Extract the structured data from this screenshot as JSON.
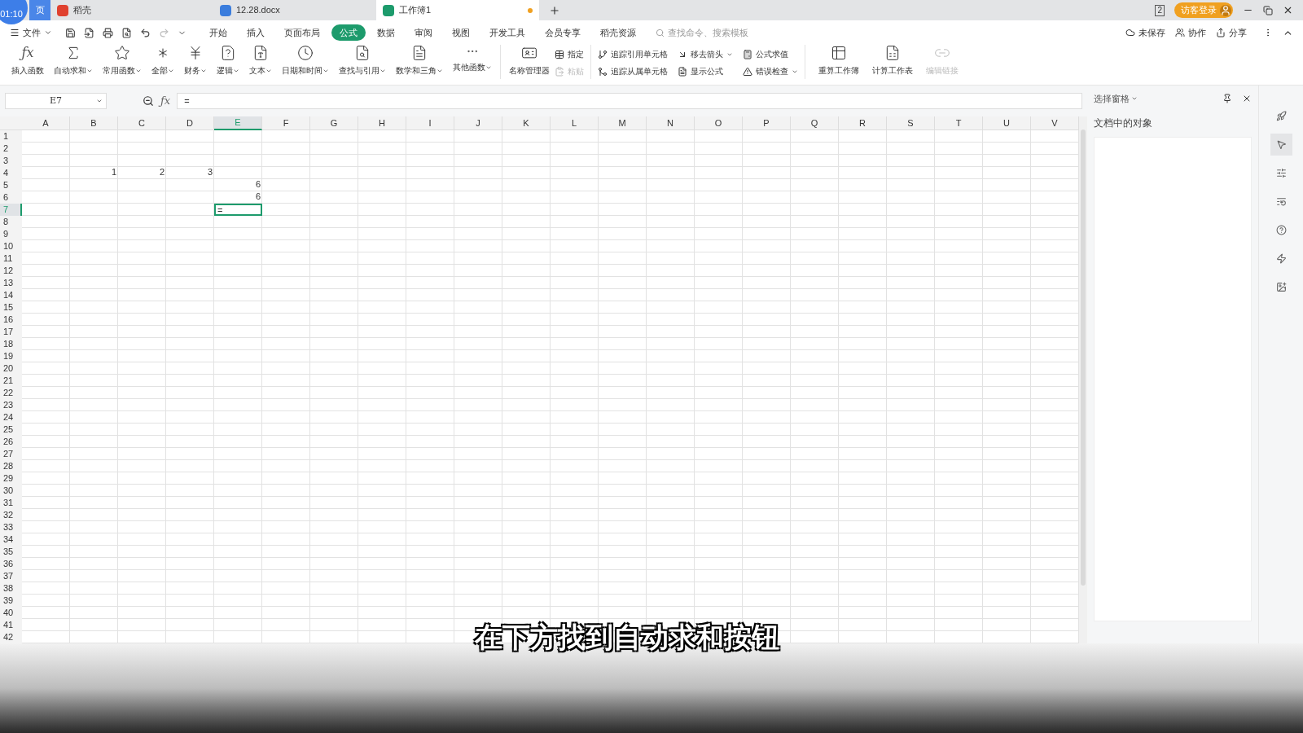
{
  "recording_timer": "01:10",
  "tabs": [
    {
      "label": "页",
      "kind": "home",
      "selected": false,
      "unsaved": false
    },
    {
      "label": "稻壳",
      "kind": "docer",
      "selected": false,
      "unsaved": false
    },
    {
      "label": "12.28.docx",
      "kind": "doc",
      "selected": false,
      "unsaved": false
    },
    {
      "label": "工作簿1",
      "kind": "sheet",
      "selected": true,
      "unsaved": true
    }
  ],
  "window_badge": "2",
  "login_button": "访客登录",
  "file_menu": "文件",
  "menu_tabs": [
    {
      "label": "开始",
      "selected": false
    },
    {
      "label": "插入",
      "selected": false
    },
    {
      "label": "页面布局",
      "selected": false
    },
    {
      "label": "公式",
      "selected": true
    },
    {
      "label": "数据",
      "selected": false
    },
    {
      "label": "审阅",
      "selected": false
    },
    {
      "label": "视图",
      "selected": false
    },
    {
      "label": "开发工具",
      "selected": false
    },
    {
      "label": "会员专享",
      "selected": false
    },
    {
      "label": "稻壳资源",
      "selected": false
    }
  ],
  "command_search": {
    "placeholder": "查找命令、搜索模板"
  },
  "header_actions": [
    {
      "label": "未保存",
      "kind": "cloud"
    },
    {
      "label": "协作",
      "kind": "people"
    },
    {
      "label": "分享",
      "kind": "share"
    }
  ],
  "ribbon_functions": [
    {
      "label": "插入函数",
      "kind": "fx",
      "symbol": "ƒx",
      "dropdown": false
    },
    {
      "label": "自动求和",
      "kind": "sigma",
      "dropdown": true
    },
    {
      "label": "常用函数",
      "kind": "star",
      "dropdown": true
    },
    {
      "label": "全部",
      "kind": "asterisk",
      "dropdown": true
    },
    {
      "label": "财务",
      "kind": "yen",
      "dropdown": true
    },
    {
      "label": "逻辑",
      "kind": "question",
      "dropdown": true
    },
    {
      "label": "文本",
      "kind": "text",
      "dropdown": true
    },
    {
      "label": "日期和时间",
      "kind": "clock",
      "dropdown": true
    },
    {
      "label": "查找与引用",
      "kind": "search",
      "dropdown": true
    },
    {
      "label": "数学和三角",
      "kind": "math",
      "dropdown": true
    },
    {
      "label": "其他函数",
      "kind": "more",
      "dropdown": true
    }
  ],
  "ribbon_names": {
    "big": {
      "label": "名称管理器"
    },
    "small": [
      {
        "label": "指定",
        "disabled": false
      },
      {
        "label": "粘贴",
        "disabled": true
      }
    ]
  },
  "ribbon_audit": [
    {
      "label": "追踪引用单元格",
      "kind": "trace",
      "dropdown": false
    },
    {
      "label": "追踪从属单元格",
      "kind": "dependents",
      "dropdown": false
    },
    {
      "label": "移去箭头",
      "kind": "remove",
      "dropdown": true
    },
    {
      "label": "显示公式",
      "kind": "showfx",
      "dropdown": false
    },
    {
      "label": "公式求值",
      "kind": "evaluate",
      "dropdown": false
    },
    {
      "label": "错误检查",
      "kind": "warning",
      "dropdown": true
    }
  ],
  "ribbon_calc": [
    {
      "label": "重算工作簿",
      "kind": "workbook",
      "disabled": false
    },
    {
      "label": "计算工作表",
      "kind": "sheet",
      "disabled": false
    },
    {
      "label": "编辑链接",
      "kind": "link",
      "disabled": true
    }
  ],
  "name_box": "E7",
  "formula_bar": {
    "symbol": "ƒx",
    "value": "="
  },
  "columns": [
    {
      "label": "A",
      "selected": false
    },
    {
      "label": "B",
      "selected": false
    },
    {
      "label": "C",
      "selected": false
    },
    {
      "label": "D",
      "selected": false
    },
    {
      "label": "E",
      "selected": true
    },
    {
      "label": "F",
      "selected": false
    },
    {
      "label": "G",
      "selected": false
    },
    {
      "label": "H",
      "selected": false
    },
    {
      "label": "I",
      "selected": false
    },
    {
      "label": "J",
      "selected": false
    },
    {
      "label": "K",
      "selected": false
    },
    {
      "label": "L",
      "selected": false
    },
    {
      "label": "M",
      "selected": false
    },
    {
      "label": "N",
      "selected": false
    },
    {
      "label": "O",
      "selected": false
    },
    {
      "label": "P",
      "selected": false
    },
    {
      "label": "Q",
      "selected": false
    },
    {
      "label": "R",
      "selected": false
    },
    {
      "label": "S",
      "selected": false
    },
    {
      "label": "T",
      "selected": false
    },
    {
      "label": "U",
      "selected": false
    },
    {
      "label": "V",
      "selected": false
    }
  ],
  "rows": [
    {
      "label": "1",
      "selected": false
    },
    {
      "label": "2",
      "selected": false
    },
    {
      "label": "3",
      "selected": false
    },
    {
      "label": "4",
      "selected": false,
      "cells": [
        null,
        {
          "value": "1",
          "selected": false
        },
        {
          "value": "2",
          "selected": false
        },
        {
          "value": "3",
          "selected": false
        }
      ]
    },
    {
      "label": "5",
      "selected": false,
      "cells": [
        null,
        null,
        null,
        null,
        {
          "value": "6",
          "selected": false
        }
      ]
    },
    {
      "label": "6",
      "selected": false,
      "cells": [
        null,
        null,
        null,
        null,
        {
          "value": "6",
          "selected": false
        }
      ]
    },
    {
      "label": "7",
      "selected": true,
      "cells": [
        null,
        null,
        null,
        null,
        {
          "value": "=",
          "selected": true
        }
      ]
    },
    {
      "label": "8",
      "selected": false
    },
    {
      "label": "9",
      "selected": false
    },
    {
      "label": "10",
      "selected": false
    },
    {
      "label": "11",
      "selected": false
    },
    {
      "label": "12",
      "selected": false
    },
    {
      "label": "13",
      "selected": false
    },
    {
      "label": "14",
      "selected": false
    },
    {
      "label": "15",
      "selected": false
    },
    {
      "label": "16",
      "selected": false
    },
    {
      "label": "17",
      "selected": false
    },
    {
      "label": "18",
      "selected": false
    },
    {
      "label": "19",
      "selected": false
    },
    {
      "label": "20",
      "selected": false
    },
    {
      "label": "21",
      "selected": false
    },
    {
      "label": "22",
      "selected": false
    },
    {
      "label": "23",
      "selected": false
    },
    {
      "label": "24",
      "selected": false
    },
    {
      "label": "25",
      "selected": false
    },
    {
      "label": "26",
      "selected": false
    },
    {
      "label": "27",
      "selected": false
    },
    {
      "label": "28",
      "selected": false
    },
    {
      "label": "29",
      "selected": false
    },
    {
      "label": "30",
      "selected": false
    },
    {
      "label": "31",
      "selected": false
    },
    {
      "label": "32",
      "selected": false
    },
    {
      "label": "33",
      "selected": false
    },
    {
      "label": "34",
      "selected": false
    },
    {
      "label": "35",
      "selected": false
    },
    {
      "label": "36",
      "selected": false
    },
    {
      "label": "37",
      "selected": false
    },
    {
      "label": "38",
      "selected": false
    },
    {
      "label": "39",
      "selected": false
    },
    {
      "label": "40",
      "selected": false
    },
    {
      "label": "41",
      "selected": false
    },
    {
      "label": "42",
      "selected": false
    }
  ],
  "side_pane": {
    "title": "选择窗格",
    "section": "文档中的对象"
  },
  "side_tools": [
    {
      "kind": "rocket",
      "selected": false
    },
    {
      "kind": "pointer",
      "selected": true
    },
    {
      "kind": "sliders",
      "selected": false
    },
    {
      "kind": "list",
      "selected": false
    },
    {
      "kind": "help",
      "selected": false
    },
    {
      "kind": "bolt",
      "selected": false
    },
    {
      "kind": "image",
      "selected": false
    }
  ],
  "subtitle": "在下方找到自动求和按钮"
}
